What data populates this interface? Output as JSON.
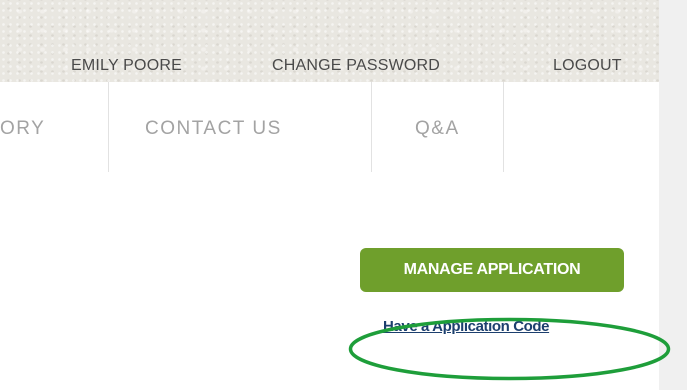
{
  "user_links": {
    "user_name": "EMILY POORE",
    "change_password": "CHANGE PASSWORD",
    "logout": "LOGOUT"
  },
  "nav": {
    "items": [
      {
        "label": "ORY"
      },
      {
        "label": "CONTACT US"
      },
      {
        "label": "Q&A"
      }
    ]
  },
  "actions": {
    "manage_application": "MANAGE APPLICATION",
    "application_code_link": "Have a Application Code"
  },
  "colors": {
    "button_green": "#6f9f2c",
    "link_blue": "#1c3f6e",
    "annotation_green": "#1e9e3a"
  }
}
